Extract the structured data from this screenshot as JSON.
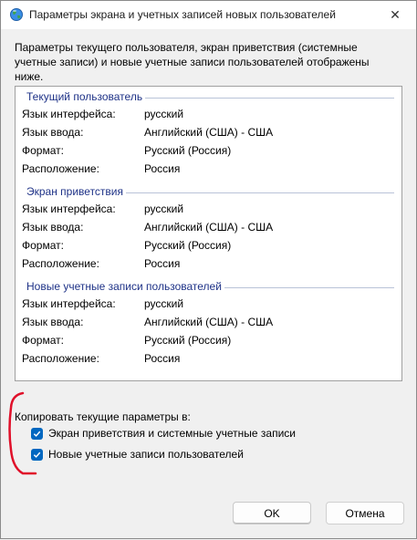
{
  "window": {
    "title": "Параметры экрана и учетных записей новых пользователей",
    "close_label": "✕"
  },
  "intro_text": "Параметры текущего пользователя, экран приветствия (системные учетные записи) и новые учетные записи пользователей отображены ниже.",
  "sections": [
    {
      "title": "Текущий пользователь",
      "rows": [
        {
          "label": "Язык интерфейса:",
          "value": "русский"
        },
        {
          "label": "Язык ввода:",
          "value": "Английский (США) - США"
        },
        {
          "label": "Формат:",
          "value": "Русский (Россия)"
        },
        {
          "label": "Расположение:",
          "value": "Россия"
        }
      ]
    },
    {
      "title": "Экран приветствия",
      "rows": [
        {
          "label": "Язык интерфейса:",
          "value": "русский"
        },
        {
          "label": "Язык ввода:",
          "value": "Английский (США) - США"
        },
        {
          "label": "Формат:",
          "value": "Русский (Россия)"
        },
        {
          "label": "Расположение:",
          "value": "Россия"
        }
      ]
    },
    {
      "title": "Новые учетные записи пользователей",
      "rows": [
        {
          "label": "Язык интерфейса:",
          "value": "русский"
        },
        {
          "label": "Язык ввода:",
          "value": "Английский (США) - США"
        },
        {
          "label": "Формат:",
          "value": "Русский (Россия)"
        },
        {
          "label": "Расположение:",
          "value": "Россия"
        }
      ]
    }
  ],
  "copy": {
    "label": "Копировать текущие параметры в:",
    "options": [
      {
        "label": "Экран приветствия и системные учетные записи",
        "checked": true
      },
      {
        "label": "Новые учетные записи пользователей",
        "checked": true
      }
    ]
  },
  "buttons": {
    "ok": "OK",
    "cancel": "Отмена"
  },
  "colors": {
    "accent": "#0067c0",
    "section_title": "#1e3287",
    "annotation": "#e0102a"
  }
}
